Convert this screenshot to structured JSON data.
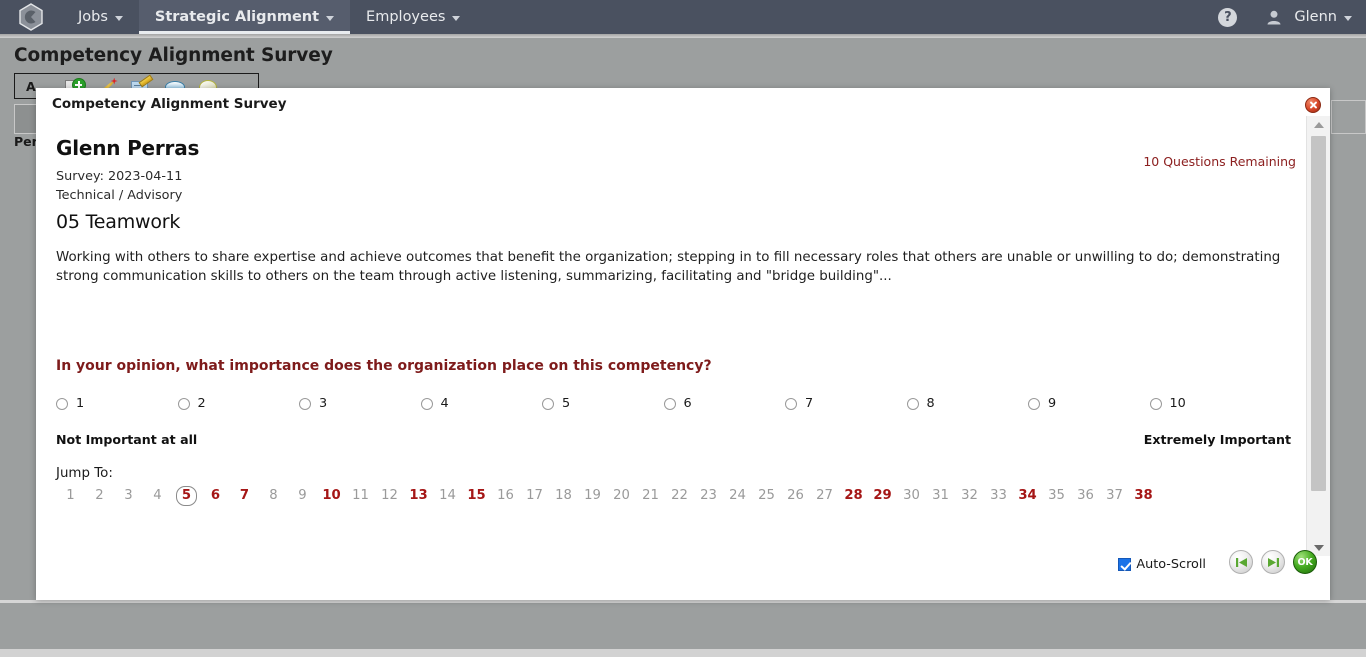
{
  "navbar": {
    "logo_icon": "hexagon-logo-icon",
    "items": [
      {
        "label": "Jobs",
        "active": false
      },
      {
        "label": "Strategic Alignment",
        "active": true
      },
      {
        "label": "Employees",
        "active": false
      }
    ],
    "help_label": "?",
    "user_label": "Glenn"
  },
  "page": {
    "title": "Competency Alignment Survey",
    "toolbar_label": "A",
    "toolbar_dots": "..",
    "side_label": "Per"
  },
  "modal": {
    "title": "Competency Alignment Survey",
    "close_label": "×",
    "person_name": "Glenn Perras",
    "survey_line": "Survey: 2023-04-11",
    "track_line": "Technical / Advisory",
    "questions_remaining": "10 Questions Remaining",
    "competency_title": "05 Teamwork",
    "competency_description": "Working with others to share expertise and achieve outcomes that benefit the organization; stepping in to fill necessary roles that others are unable or unwilling to do; demonstrating strong communication skills to others on the team through active listening, summarizing, facilitating and \"bridge building\"...",
    "opinion_question": "In your opinion, what importance does the organization place on this competency?",
    "scale": {
      "options": [
        "1",
        "2",
        "3",
        "4",
        "5",
        "6",
        "7",
        "8",
        "9",
        "10"
      ],
      "selected": null,
      "anchor_low": "Not Important at all",
      "anchor_high": "Extremely Important"
    },
    "jump_to": {
      "label": "Jump To:",
      "current": 5,
      "pending": [
        6,
        7,
        10,
        13,
        15,
        28,
        29,
        34,
        38
      ],
      "numbers": [
        1,
        2,
        3,
        4,
        5,
        6,
        7,
        8,
        9,
        10,
        11,
        12,
        13,
        14,
        15,
        16,
        17,
        18,
        19,
        20,
        21,
        22,
        23,
        24,
        25,
        26,
        27,
        28,
        29,
        30,
        31,
        32,
        33,
        34,
        35,
        36,
        37,
        38
      ]
    },
    "footer": {
      "autoscroll_label": "Auto-Scroll",
      "autoscroll_checked": true,
      "prev_icon": "skip-to-first-icon",
      "next_icon": "skip-to-last-icon",
      "ok_label": "OK"
    },
    "scrollbar": {
      "up_icon": "scroll-up-arrow-icon",
      "down_icon": "scroll-down-arrow-icon"
    }
  },
  "colors": {
    "navbar_bg": "#4a5160",
    "page_bg": "#9c9f9f",
    "accent_red": "#a51616",
    "question_red": "#7e1b1b",
    "remaining_red": "#8c2020",
    "ok_green": "#44ab1f",
    "checkbox_blue": "#1a73e8"
  }
}
